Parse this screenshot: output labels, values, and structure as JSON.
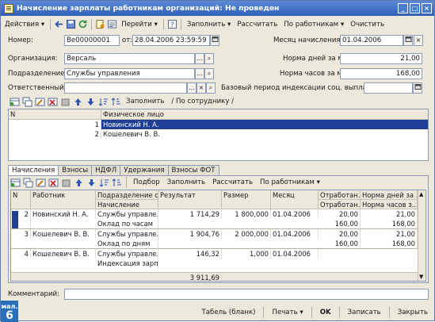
{
  "window": {
    "title": "Начисление зарплаты работникам организаций: Не проведен"
  },
  "toolbar": {
    "actions": "Действия",
    "goto": "Перейти",
    "fill": "Заполнить",
    "calc": "Рассчитать",
    "by_workers": "По работникам",
    "clear": "Очистить"
  },
  "header": {
    "number_label": "Номер:",
    "number_value": "Ве00000001",
    "from_label": "от:",
    "date_value": "28.04.2006 23:59:59",
    "month_label": "Месяц начисления:",
    "month_value": "01.04.2006",
    "org_label": "Организация:",
    "org_value": "Версаль",
    "days_norm_label": "Норма дней за месяц:",
    "days_norm_value": "21,00",
    "dept_label": "Подразделение:",
    "dept_value": "Службы управления",
    "hours_norm_label": "Норма часов за месяц:",
    "hours_norm_value": "168,00",
    "resp_label": "Ответственный:",
    "resp_value": "",
    "index_label": "Базовый период индексации соц. выплат:",
    "index_value": ""
  },
  "upper_toolbar": {
    "fill": "Заполнить",
    "by_employee": "/ По сотруднику /"
  },
  "upper_table": {
    "columns": [
      "N",
      "Физическое лицо"
    ],
    "rows": [
      {
        "n": "1",
        "name": "Новинский Н. А."
      },
      {
        "n": "2",
        "name": "Кошелевич В. В."
      }
    ]
  },
  "tabs": [
    "Начисления",
    "Взносы",
    "НДФЛ",
    "Удержания",
    "Взносы ФОТ"
  ],
  "lower_toolbar": {
    "select": "Подбор",
    "fill": "Заполнить",
    "calc": "Рассчитать",
    "by_workers": "По работникам"
  },
  "lower_table": {
    "columns": {
      "n": "N",
      "worker": "Работник",
      "dept": "Подразделение о...",
      "accrual": "Начисление",
      "result": "Результат",
      "size": "Размер",
      "month": "Месяц",
      "worked1": "Отработан...",
      "worked2": "Отработан...",
      "norm_days": "Норма дней за ...",
      "norm_hours": "Норма часов з..."
    },
    "rows": [
      {
        "n": "2",
        "worker": "Новинский Н. А.",
        "dept": "Службы управле...",
        "accrual": "Оклад по часам",
        "result": "1 714,29",
        "size": "1 800,000",
        "month": "01.04.2006",
        "w1": "20,00",
        "w2": "160,00",
        "nd": "21,00",
        "nh": "168,00"
      },
      {
        "n": "3",
        "worker": "Кошелевич В. В.",
        "dept": "Службы управле...",
        "accrual": "Оклад по дням",
        "result": "1 904,76",
        "size": "2 000,000",
        "month": "01.04.2006",
        "w1": "20,00",
        "w2": "160,00",
        "nd": "21,00",
        "nh": "168,00"
      },
      {
        "n": "4",
        "worker": "Кошелевич В. В.",
        "dept": "Службы управле...",
        "accrual": "Индексация зарп...",
        "result": "146,32",
        "size": "1,000",
        "month": "01.04.2006",
        "w1": "",
        "w2": "",
        "nd": "",
        "nh": ""
      }
    ],
    "total": "3 911,69"
  },
  "comment": {
    "label": "Комментарий:",
    "value": ""
  },
  "footer": {
    "timesheet": "Табель (бланк)",
    "print": "Печать",
    "ok": "OK",
    "save": "Записать",
    "close": "Закрыть"
  },
  "badge": {
    "line1": "мал.",
    "line2": "6"
  }
}
